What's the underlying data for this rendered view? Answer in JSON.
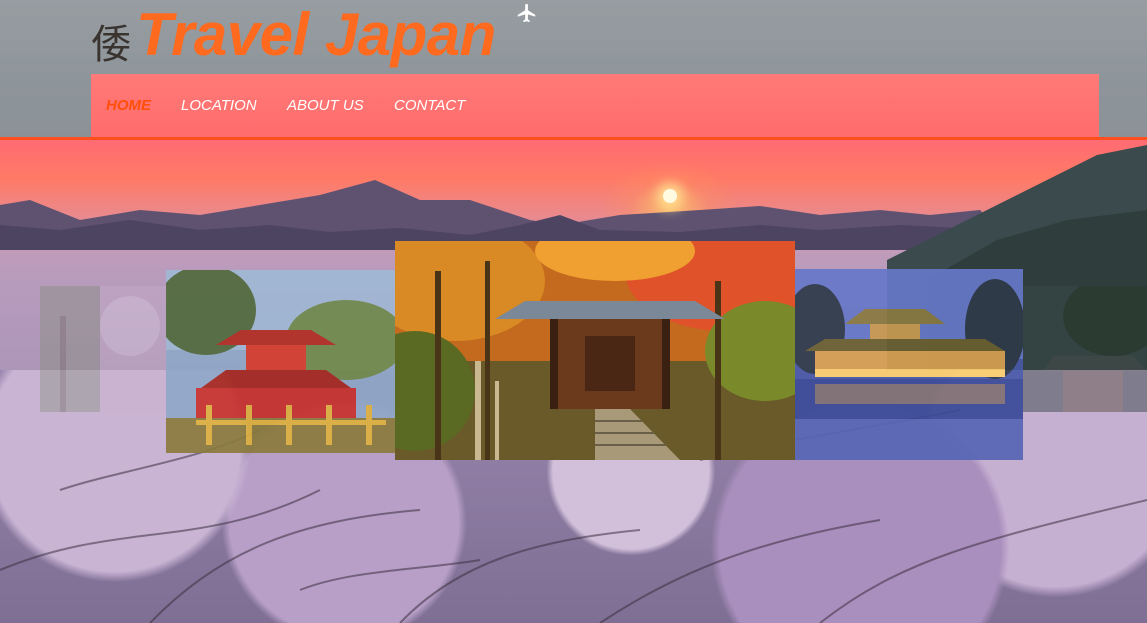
{
  "brand": {
    "kanji": "倭",
    "title": "Travel Japan",
    "icon": "airplane-icon",
    "title_color": "#ff6a1f"
  },
  "nav": {
    "items": [
      {
        "label": "HOME",
        "active": true
      },
      {
        "label": "LOCATION",
        "active": false
      },
      {
        "label": "ABOUT US",
        "active": false
      },
      {
        "label": "CONTACT",
        "active": false
      }
    ],
    "bar_color": "#ff706e",
    "active_color": "#ff4f0a"
  },
  "carousel": {
    "slides": [
      {
        "subject": "forest-shrine-faded"
      },
      {
        "subject": "red-pagoda-shrine"
      },
      {
        "subject": "autumn-temple"
      },
      {
        "subject": "lakeside-temple-night"
      },
      {
        "subject": "pagoda-faded"
      }
    ]
  }
}
